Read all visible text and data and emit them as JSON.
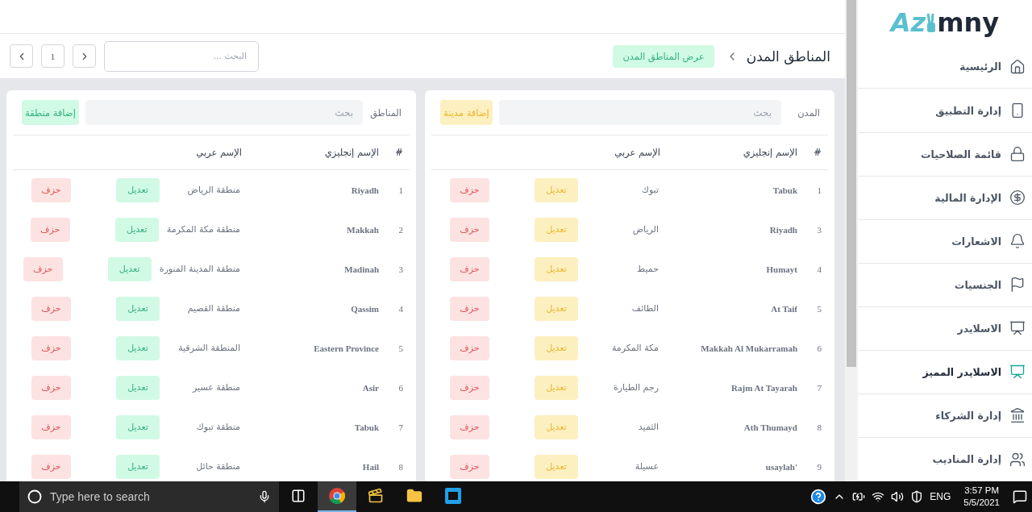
{
  "header": {
    "title": "المناطق المدن",
    "view_button": "عرض المناطق المدن",
    "search": {
      "placeholder": "البحث ..."
    },
    "pager": {
      "page": "1"
    }
  },
  "tables": [
    {
      "kind": "warning",
      "label": "المدن",
      "search": {
        "placeholder": "بحث"
      },
      "add_button": "إضافة مدينة",
      "columns": [
        "#",
        "الإسم إنجليزي",
        "الإسم عربي"
      ],
      "rows": [
        {
          "index": "1",
          "en": "Tabuk",
          "ar": "تبوك",
          "edit": "تعديل",
          "delete": "حزف"
        },
        {
          "index": "3",
          "en": "Riyadh",
          "ar": "الرياض",
          "edit": "تعديل",
          "delete": "حزف"
        },
        {
          "index": "4",
          "en": "Humayt",
          "ar": "حميط",
          "edit": "تعديل",
          "delete": "حزف"
        },
        {
          "index": "5",
          "en": "At Taif",
          "ar": "الطائف",
          "edit": "تعديل",
          "delete": "حزف"
        },
        {
          "index": "6",
          "en": "Makkah Al Mukarramah",
          "ar": "مكة المكرمة",
          "edit": "تعديل",
          "delete": "حزف"
        },
        {
          "index": "7",
          "en": "Rajm At Tayarah",
          "ar": "رجم الطيارة",
          "edit": "تعديل",
          "delete": "حزف"
        },
        {
          "index": "8",
          "en": "Ath Thumayd",
          "ar": "الثميد",
          "edit": "تعديل",
          "delete": "حزف"
        },
        {
          "index": "9",
          "en": "usaylah'",
          "ar": "عسيلة",
          "edit": "تعديل",
          "delete": "حزف"
        }
      ]
    },
    {
      "kind": "success",
      "label": "المناطق",
      "search": {
        "placeholder": "بحث"
      },
      "add_button": "إضافة منطقة",
      "columns": [
        "#",
        "الإسم إنجليزي",
        "الإسم عربي"
      ],
      "rows": [
        {
          "index": "1",
          "en": "Riyadh",
          "ar": "منطقة الرياض",
          "edit": "تعديل",
          "delete": "حزف"
        },
        {
          "index": "2",
          "en": "Makkah",
          "ar": "منطقة مكة المكرمة",
          "edit": "تعديل",
          "delete": "حزف"
        },
        {
          "index": "3",
          "en": "Madinah",
          "ar": "منطقة المدينة المنورة",
          "edit": "تعديل",
          "delete": "حزف"
        },
        {
          "index": "4",
          "en": "Qassim",
          "ar": "منطقة القصيم",
          "edit": "تعديل",
          "delete": "حزف"
        },
        {
          "index": "5",
          "en": "Eastern Province",
          "ar": "المنطقة الشرقية",
          "edit": "تعديل",
          "delete": "حزف"
        },
        {
          "index": "6",
          "en": "Asir",
          "ar": "منطقة عسير",
          "edit": "تعديل",
          "delete": "حزف"
        },
        {
          "index": "7",
          "en": "Tabuk",
          "ar": "منطقة تبوك",
          "edit": "تعديل",
          "delete": "حزف"
        },
        {
          "index": "8",
          "en": "Hail",
          "ar": "منطقة حائل",
          "edit": "تعديل",
          "delete": "حزف"
        }
      ]
    }
  ],
  "sidebar": {
    "logo": {
      "left": "Az",
      "right": "mny"
    },
    "items": [
      {
        "label": "الرئيسية",
        "selected": false
      },
      {
        "label": "إدارة التطبيق",
        "selected": false
      },
      {
        "label": "قائمة الصلاحيات",
        "selected": false
      },
      {
        "label": "الإدارة المالية",
        "selected": false
      },
      {
        "label": "الاشعارات",
        "selected": false
      },
      {
        "label": "الجنسيات",
        "selected": false
      },
      {
        "label": "الاسلايدر",
        "selected": false
      },
      {
        "label": "الاسلايدر المميز",
        "selected": true
      },
      {
        "label": "إدارة الشركاء",
        "selected": false
      },
      {
        "label": "إدارة المناديب",
        "selected": false
      }
    ]
  },
  "taskbar": {
    "search": {
      "placeholder": "Type here to search"
    },
    "apps": [
      {
        "selected": true
      },
      {
        "selected": false
      },
      {
        "selected": false
      },
      {
        "selected": false
      }
    ],
    "language": "ENG",
    "time": "3:57 PM",
    "date": "5/5/2021"
  }
}
